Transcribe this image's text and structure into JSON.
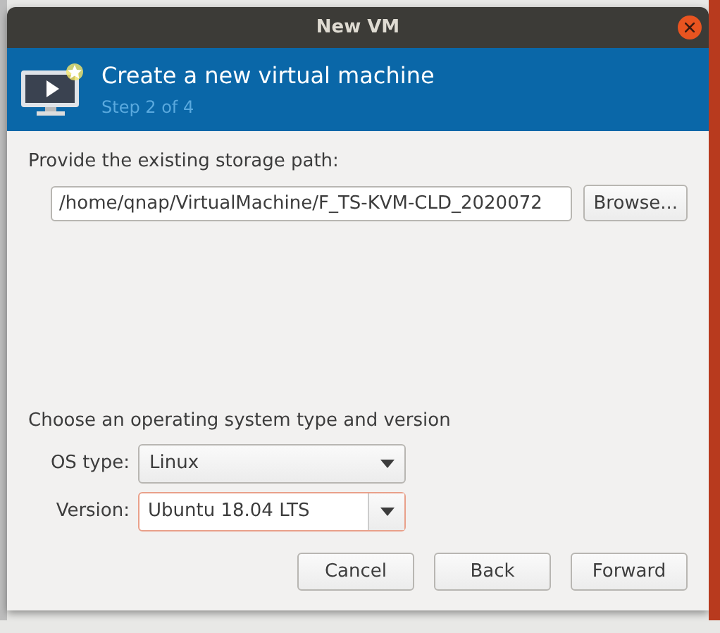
{
  "window": {
    "title": "New VM"
  },
  "header": {
    "title": "Create a new virtual machine",
    "step": "Step 2 of 4"
  },
  "storage": {
    "label": "Provide the existing storage path:",
    "value": "/home/qnap/VirtualMachine/F_TS-KVM-CLD_2020072",
    "browse": "Browse..."
  },
  "os": {
    "label": "Choose an operating system type and version",
    "fields": [
      {
        "label": "OS type:",
        "value": "Linux",
        "kind": "combo"
      },
      {
        "label": "Version:",
        "value": "Ubuntu 18.04 LTS",
        "kind": "entry"
      }
    ]
  },
  "buttons": [
    "Cancel",
    "Back",
    "Forward"
  ]
}
